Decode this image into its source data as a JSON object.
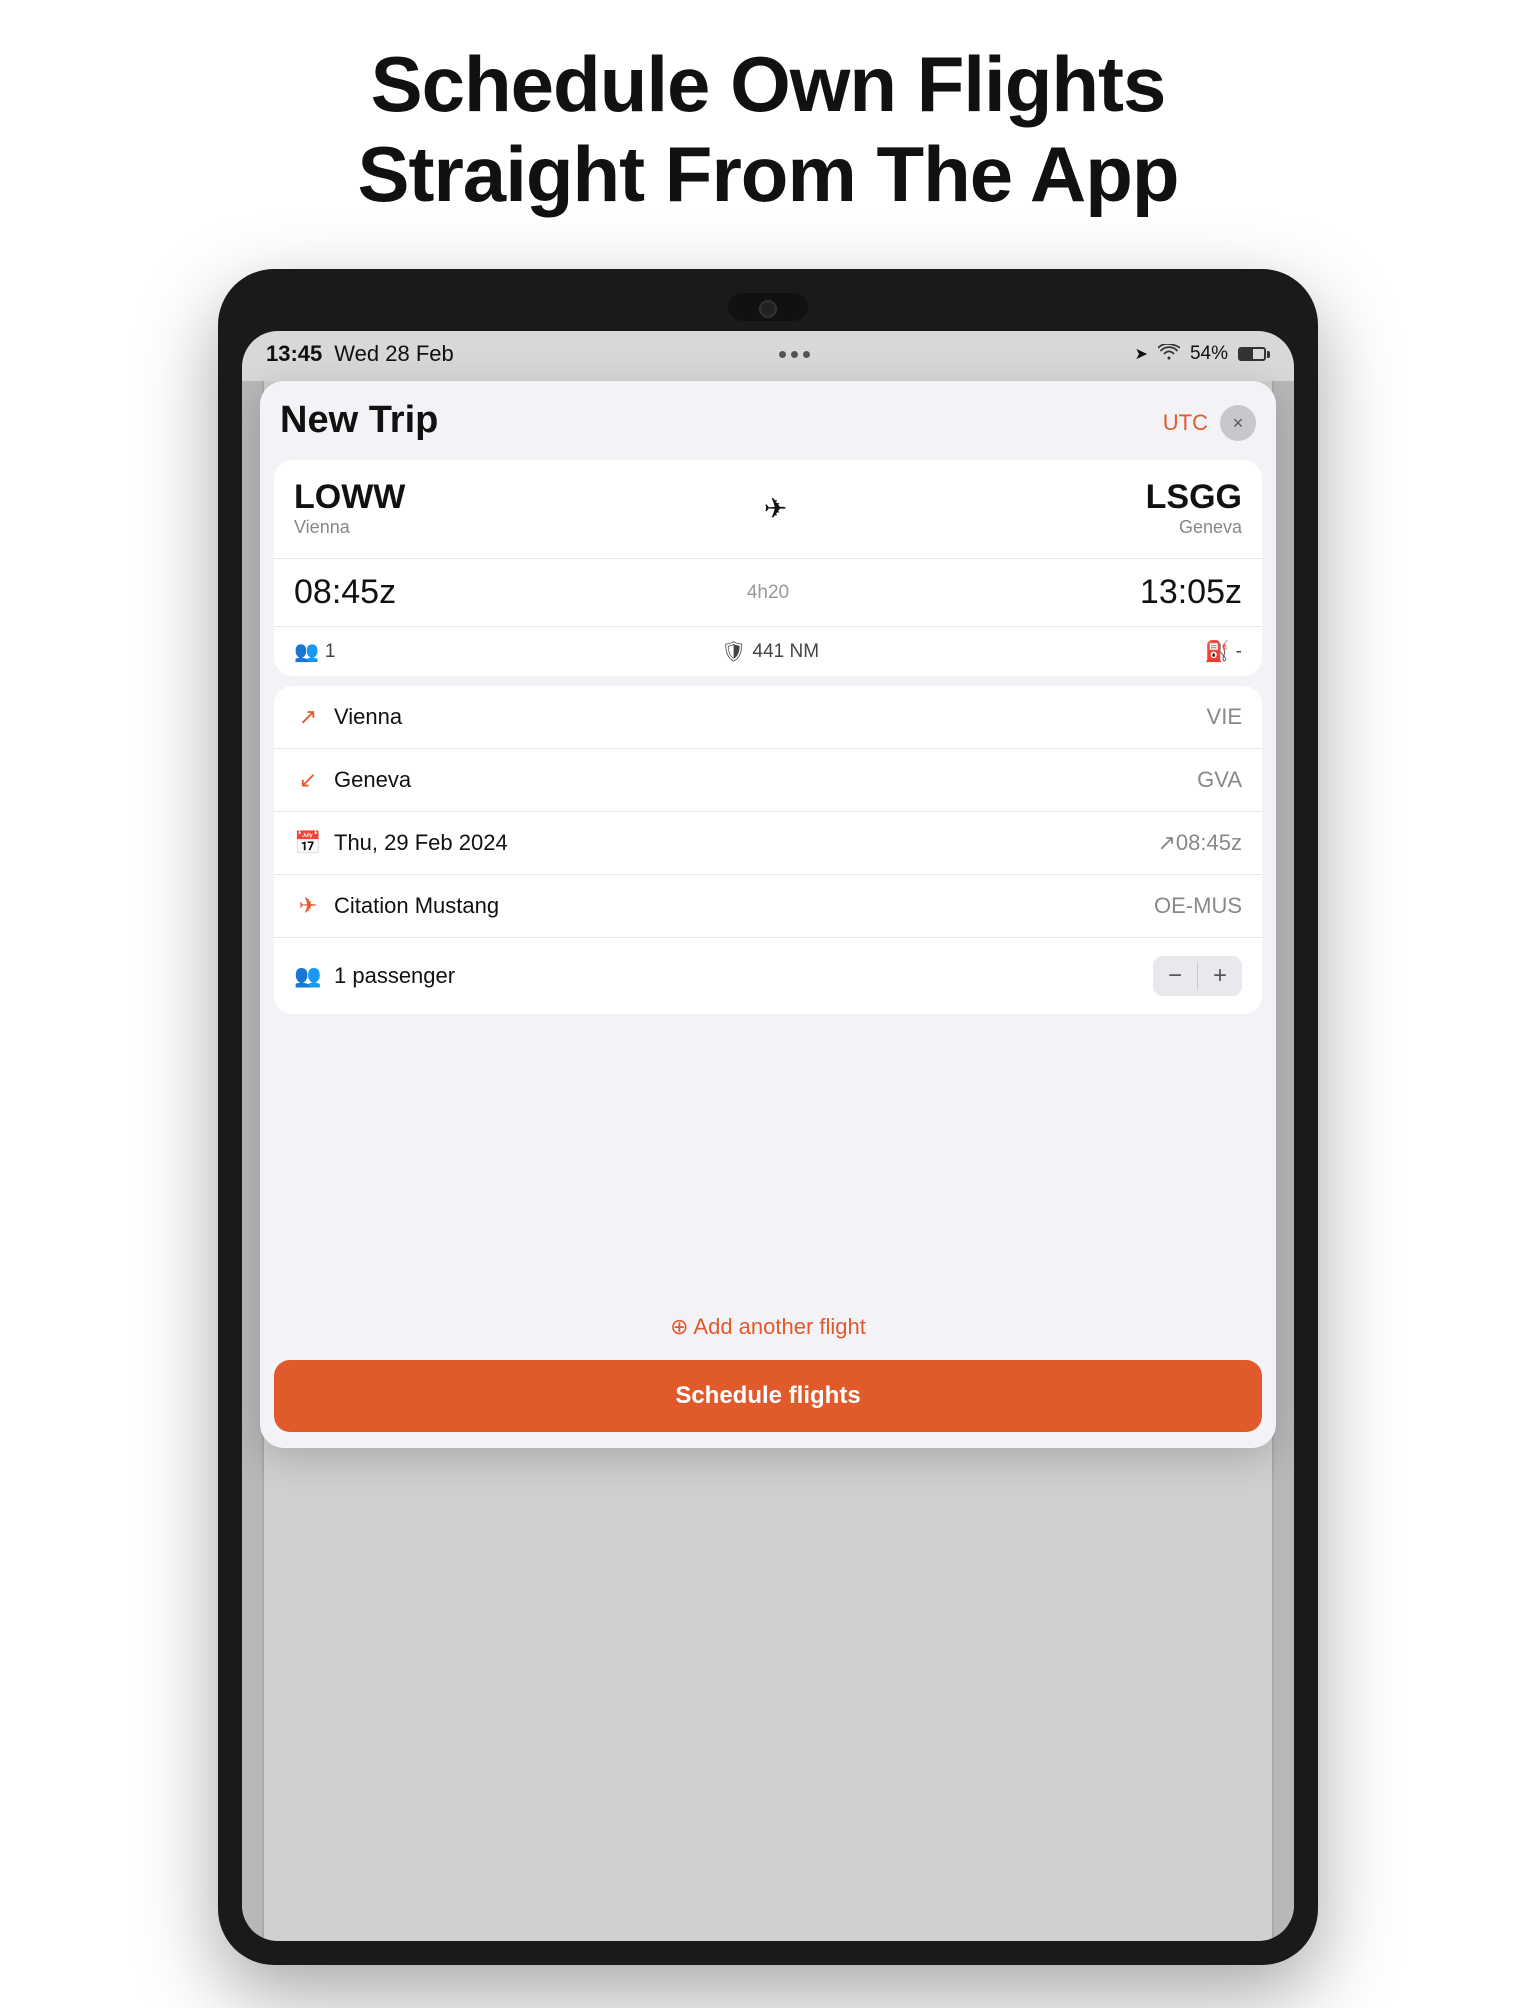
{
  "hero": {
    "line1": "Schedule Own Flights",
    "line2": "Straight From The App"
  },
  "statusBar": {
    "time": "13:45",
    "date": "Wed 28 Feb",
    "battery": "54%",
    "dots": [
      "•",
      "•",
      "•"
    ]
  },
  "modal": {
    "title": "New Trip",
    "utcLabel": "UTC",
    "closeLabel": "×"
  },
  "flightCard": {
    "originCode": "LOWW",
    "originName": "Vienna",
    "destCode": "LSGG",
    "destName": "Geneva",
    "departTime": "08:45z",
    "arriveTime": "13:05z",
    "duration": "4h20",
    "passengers": "1",
    "distance": "441 NM",
    "fuelDash": "-"
  },
  "detailList": [
    {
      "icon": "takeoff",
      "label": "Vienna",
      "value": "VIE"
    },
    {
      "icon": "landing",
      "label": "Geneva",
      "value": "GVA"
    },
    {
      "icon": "calendar",
      "label": "Thu, 29 Feb 2024",
      "value": "↗08:45z"
    },
    {
      "icon": "plane",
      "label": "Citation Mustang",
      "value": "OE-MUS"
    },
    {
      "icon": "pax",
      "label": "1 passenger",
      "value": ""
    }
  ],
  "addFlight": {
    "label": "⊕ Add another flight"
  },
  "scheduleBtn": {
    "label": "Schedule flights"
  },
  "bgRows": [
    "",
    "",
    "",
    ""
  ]
}
